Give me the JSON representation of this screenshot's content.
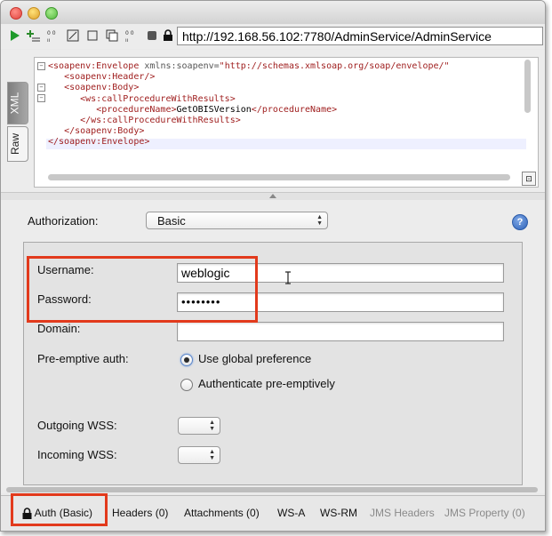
{
  "toolbar": {
    "url": "http://192.168.56.102:7780/AdminService/AdminService"
  },
  "request": {
    "side_tabs": [
      "XML",
      "Raw"
    ],
    "xml_lines": [
      {
        "tag": "<soapenv:Envelope",
        "attr": " xmlns:soapenv=",
        "val": "\"http://schemas.xmlsoap.org/soap/envelope/\""
      },
      {
        "tag": "<soapenv:Header/>"
      },
      {
        "tag": "<soapenv:Body>"
      },
      {
        "tag": "<ws:callProcedureWithResults>"
      },
      {
        "open": "<procedureName>",
        "text": "GetOBISVersion",
        "close": "</procedureName>"
      },
      {
        "tag": "</ws:callProcedureWithResults>"
      },
      {
        "tag": "</soapenv:Body>"
      },
      {
        "tag": "</soapenv:Envelope>"
      }
    ]
  },
  "auth": {
    "authorization_label": "Authorization:",
    "authorization_value": "Basic",
    "help": "?",
    "username_label": "Username:",
    "username_value": "weblogic",
    "password_label": "Password:",
    "password_value": "••••••••",
    "domain_label": "Domain:",
    "domain_value": "",
    "preemptive_label": "Pre-emptive auth:",
    "option_global": "Use global preference",
    "option_preemptive": "Authenticate pre-emptively",
    "selected_option": "global",
    "outgoing_label": "Outgoing WSS:",
    "incoming_label": "Incoming WSS:"
  },
  "bottom_tabs": {
    "auth": "Auth (Basic)",
    "headers": "Headers (0)",
    "attachments": "Attachments (0)",
    "wsa": "WS-A",
    "wsrm": "WS-RM",
    "jms_headers": "JMS Headers",
    "jms_property": "JMS Property (0)"
  },
  "colors": {
    "highlight": "#e23a1c",
    "xml_tag": "#a02020"
  }
}
